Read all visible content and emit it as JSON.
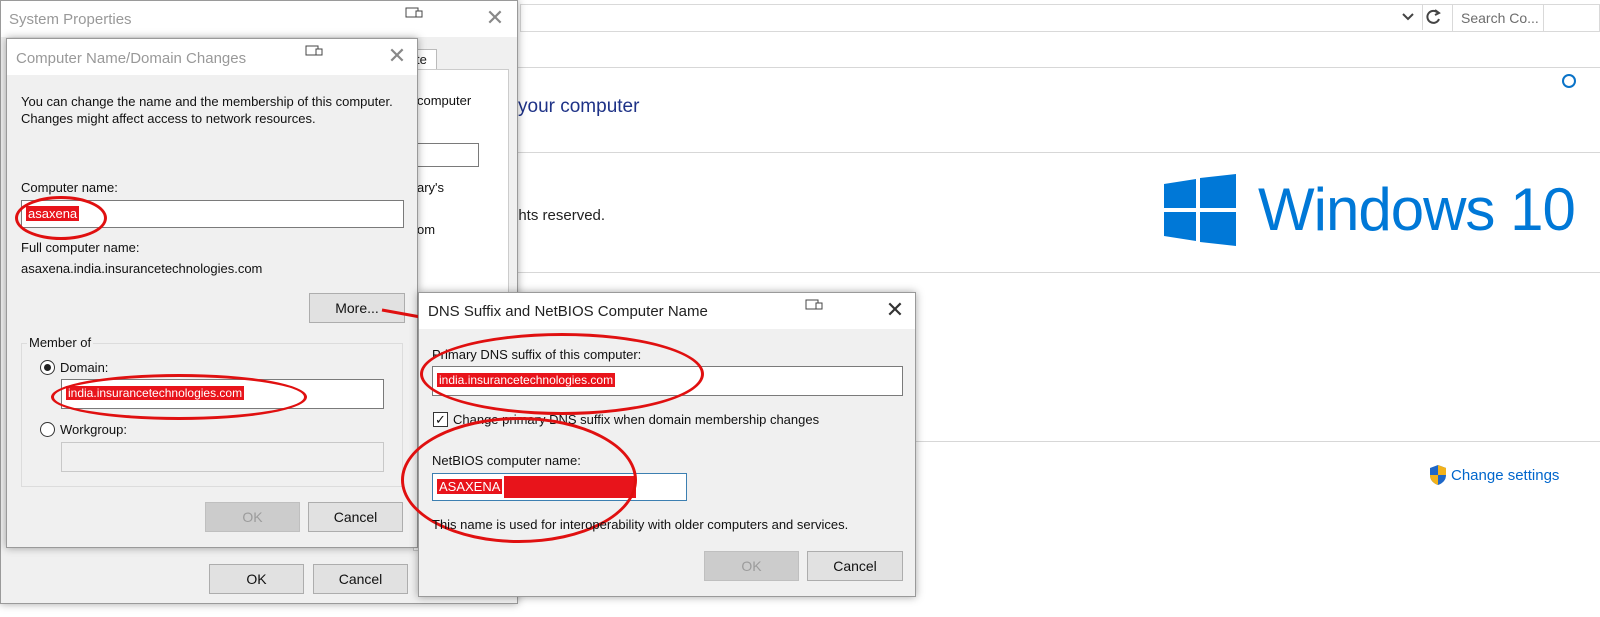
{
  "background": {
    "search_placeholder": "Search Co...",
    "heading_fragment": "your computer",
    "rights_fragment": "ghts reserved.",
    "change_settings": "Change settings",
    "windows_logo_text": "Windows 10",
    "hidden_fragments": [
      "computer",
      "ary's",
      "om",
      "te"
    ]
  },
  "system_properties": {
    "title": "System Properties",
    "ok_label": "OK",
    "cancel_label": "Cancel"
  },
  "computer_name_dialog": {
    "title": "Computer Name/Domain Changes",
    "description": "You can change the name and the membership of this computer. Changes might affect access to network resources.",
    "computer_name_label": "Computer name:",
    "computer_name_value": "asaxena",
    "full_name_label": "Full computer name:",
    "full_name_value": "asaxena.india.insurancetechnologies.com",
    "more_label": "More...",
    "member_of_label": "Member of",
    "domain_label": "Domain:",
    "domain_value": "india.insurancetechnologies.com",
    "workgroup_label": "Workgroup:",
    "workgroup_value": "",
    "ok_label": "OK",
    "cancel_label": "Cancel"
  },
  "dns_dialog": {
    "title": "DNS Suffix and NetBIOS Computer Name",
    "primary_dns_label": "Primary DNS suffix of this computer:",
    "primary_dns_value": "india.insurancetechnologies.com",
    "change_suffix_label": "Change primary DNS suffix when domain membership changes",
    "change_suffix_checked": true,
    "netbios_label": "NetBIOS computer name:",
    "netbios_value": "ASAXENA",
    "info_text": "This name is used for interoperability with older computers and services.",
    "ok_label": "OK",
    "cancel_label": "Cancel"
  },
  "colors": {
    "annotation_red": "#e01010",
    "windows_blue": "#0078d7",
    "link_blue": "#0066cc"
  }
}
